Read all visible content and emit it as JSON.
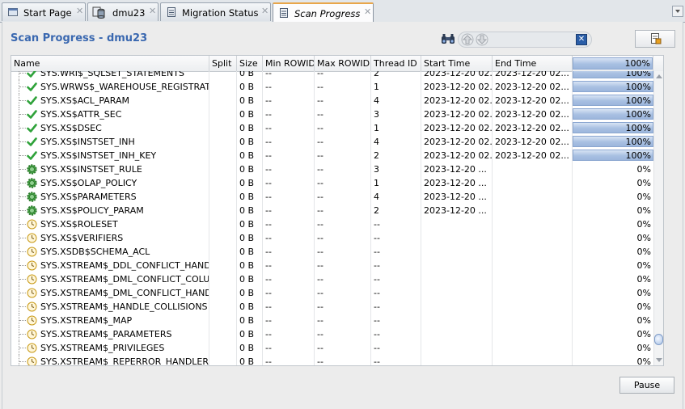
{
  "tabs": [
    {
      "label": "Start Page",
      "icon": "start-page-icon",
      "active": false
    },
    {
      "label": "dmu23",
      "icon": "database-connection-icon",
      "active": false
    },
    {
      "label": "Migration Status",
      "icon": "document-icon",
      "active": false
    },
    {
      "label": "Scan Progress",
      "icon": "document-icon",
      "active": true
    }
  ],
  "page": {
    "title": "Scan Progress - dmu23"
  },
  "toolbar": {
    "find_icon": "binoculars-icon",
    "prev_icon": "arrow-up-icon",
    "next_icon": "arrow-down-icon",
    "clear_icon": "clear-x-icon",
    "export_icon": "export-report-icon"
  },
  "table": {
    "columns": [
      "Name",
      "Split",
      "Size",
      "Min ROWID",
      "Max ROWID",
      "Thread ID",
      "Start Time",
      "End Time",
      "100%"
    ],
    "header_progress": 1.0,
    "rows": [
      {
        "name": "SYS.WRI$_SQLSET_STATEMENTS",
        "split": "",
        "size": "0 B",
        "min_rowid": "--",
        "max_rowid": "--",
        "thread": "2",
        "start": "2023-12-20 02...",
        "end": "2023-12-20 02...",
        "progress": 1.0,
        "pct": "100%",
        "status": "complete"
      },
      {
        "name": "SYS.WRWS$_WAREHOUSE_REGISTRATION",
        "split": "",
        "size": "0 B",
        "min_rowid": "--",
        "max_rowid": "--",
        "thread": "1",
        "start": "2023-12-20 02...",
        "end": "2023-12-20 02...",
        "progress": 1.0,
        "pct": "100%",
        "status": "complete"
      },
      {
        "name": "SYS.XS$ACL_PARAM",
        "split": "",
        "size": "0 B",
        "min_rowid": "--",
        "max_rowid": "--",
        "thread": "4",
        "start": "2023-12-20 02...",
        "end": "2023-12-20 02...",
        "progress": 1.0,
        "pct": "100%",
        "status": "complete"
      },
      {
        "name": "SYS.XS$ATTR_SEC",
        "split": "",
        "size": "0 B",
        "min_rowid": "--",
        "max_rowid": "--",
        "thread": "3",
        "start": "2023-12-20 02...",
        "end": "2023-12-20 02...",
        "progress": 1.0,
        "pct": "100%",
        "status": "complete"
      },
      {
        "name": "SYS.XS$DSEC",
        "split": "",
        "size": "0 B",
        "min_rowid": "--",
        "max_rowid": "--",
        "thread": "1",
        "start": "2023-12-20 02...",
        "end": "2023-12-20 02...",
        "progress": 1.0,
        "pct": "100%",
        "status": "complete"
      },
      {
        "name": "SYS.XS$INSTSET_INH",
        "split": "",
        "size": "0 B",
        "min_rowid": "--",
        "max_rowid": "--",
        "thread": "4",
        "start": "2023-12-20 02...",
        "end": "2023-12-20 02...",
        "progress": 1.0,
        "pct": "100%",
        "status": "complete"
      },
      {
        "name": "SYS.XS$INSTSET_INH_KEY",
        "split": "",
        "size": "0 B",
        "min_rowid": "--",
        "max_rowid": "--",
        "thread": "2",
        "start": "2023-12-20 02...",
        "end": "2023-12-20 02...",
        "progress": 1.0,
        "pct": "100%",
        "status": "complete"
      },
      {
        "name": "SYS.XS$INSTSET_RULE",
        "split": "",
        "size": "0 B",
        "min_rowid": "--",
        "max_rowid": "--",
        "thread": "3",
        "start": "2023-12-20 ...",
        "end": "",
        "progress": 0,
        "pct": "0%",
        "status": "running"
      },
      {
        "name": "SYS.XS$OLAP_POLICY",
        "split": "",
        "size": "0 B",
        "min_rowid": "--",
        "max_rowid": "--",
        "thread": "1",
        "start": "2023-12-20 ...",
        "end": "",
        "progress": 0,
        "pct": "0%",
        "status": "running"
      },
      {
        "name": "SYS.XS$PARAMETERS",
        "split": "",
        "size": "0 B",
        "min_rowid": "--",
        "max_rowid": "--",
        "thread": "4",
        "start": "2023-12-20 ...",
        "end": "",
        "progress": 0,
        "pct": "0%",
        "status": "running"
      },
      {
        "name": "SYS.XS$POLICY_PARAM",
        "split": "",
        "size": "0 B",
        "min_rowid": "--",
        "max_rowid": "--",
        "thread": "2",
        "start": "2023-12-20 ...",
        "end": "",
        "progress": 0,
        "pct": "0%",
        "status": "running"
      },
      {
        "name": "SYS.XS$ROLESET",
        "split": "",
        "size": "0 B",
        "min_rowid": "--",
        "max_rowid": "--",
        "thread": "--",
        "start": "",
        "end": "",
        "progress": 0,
        "pct": "0%",
        "status": "pending"
      },
      {
        "name": "SYS.XS$VERIFIERS",
        "split": "",
        "size": "0 B",
        "min_rowid": "--",
        "max_rowid": "--",
        "thread": "--",
        "start": "",
        "end": "",
        "progress": 0,
        "pct": "0%",
        "status": "pending"
      },
      {
        "name": "SYS.XSDB$SCHEMA_ACL",
        "split": "",
        "size": "0 B",
        "min_rowid": "--",
        "max_rowid": "--",
        "thread": "--",
        "start": "",
        "end": "",
        "progress": 0,
        "pct": "0%",
        "status": "pending"
      },
      {
        "name": "SYS.XSTREAM$_DDL_CONFLICT_HANDLER",
        "split": "",
        "size": "0 B",
        "min_rowid": "--",
        "max_rowid": "--",
        "thread": "--",
        "start": "",
        "end": "",
        "progress": 0,
        "pct": "0%",
        "status": "pending"
      },
      {
        "name": "SYS.XSTREAM$_DML_CONFLICT_COLUMNS",
        "split": "",
        "size": "0 B",
        "min_rowid": "--",
        "max_rowid": "--",
        "thread": "--",
        "start": "",
        "end": "",
        "progress": 0,
        "pct": "0%",
        "status": "pending"
      },
      {
        "name": "SYS.XSTREAM$_DML_CONFLICT_HANDLER",
        "split": "",
        "size": "0 B",
        "min_rowid": "--",
        "max_rowid": "--",
        "thread": "--",
        "start": "",
        "end": "",
        "progress": 0,
        "pct": "0%",
        "status": "pending"
      },
      {
        "name": "SYS.XSTREAM$_HANDLE_COLLISIONS",
        "split": "",
        "size": "0 B",
        "min_rowid": "--",
        "max_rowid": "--",
        "thread": "--",
        "start": "",
        "end": "",
        "progress": 0,
        "pct": "0%",
        "status": "pending"
      },
      {
        "name": "SYS.XSTREAM$_MAP",
        "split": "",
        "size": "0 B",
        "min_rowid": "--",
        "max_rowid": "--",
        "thread": "--",
        "start": "",
        "end": "",
        "progress": 0,
        "pct": "0%",
        "status": "pending"
      },
      {
        "name": "SYS.XSTREAM$_PARAMETERS",
        "split": "",
        "size": "0 B",
        "min_rowid": "--",
        "max_rowid": "--",
        "thread": "--",
        "start": "",
        "end": "",
        "progress": 0,
        "pct": "0%",
        "status": "pending"
      },
      {
        "name": "SYS.XSTREAM$_PRIVILEGES",
        "split": "",
        "size": "0 B",
        "min_rowid": "--",
        "max_rowid": "--",
        "thread": "--",
        "start": "",
        "end": "",
        "progress": 0,
        "pct": "0%",
        "status": "pending"
      },
      {
        "name": "SYS.XSTREAM$_REPERROR_HANDLER",
        "split": "",
        "size": "0 B",
        "min_rowid": "--",
        "max_rowid": "--",
        "thread": "--",
        "start": "",
        "end": "",
        "progress": 0,
        "pct": "0%",
        "status": "pending"
      }
    ]
  },
  "footer": {
    "pause_label": "Pause"
  },
  "colors": {
    "title": "#3a68b0",
    "progress_fill": "#a8c0e2",
    "complete_check": "#2fa23a",
    "running_gear": "#3a9a3a",
    "pending_clock": "#d8a820"
  }
}
